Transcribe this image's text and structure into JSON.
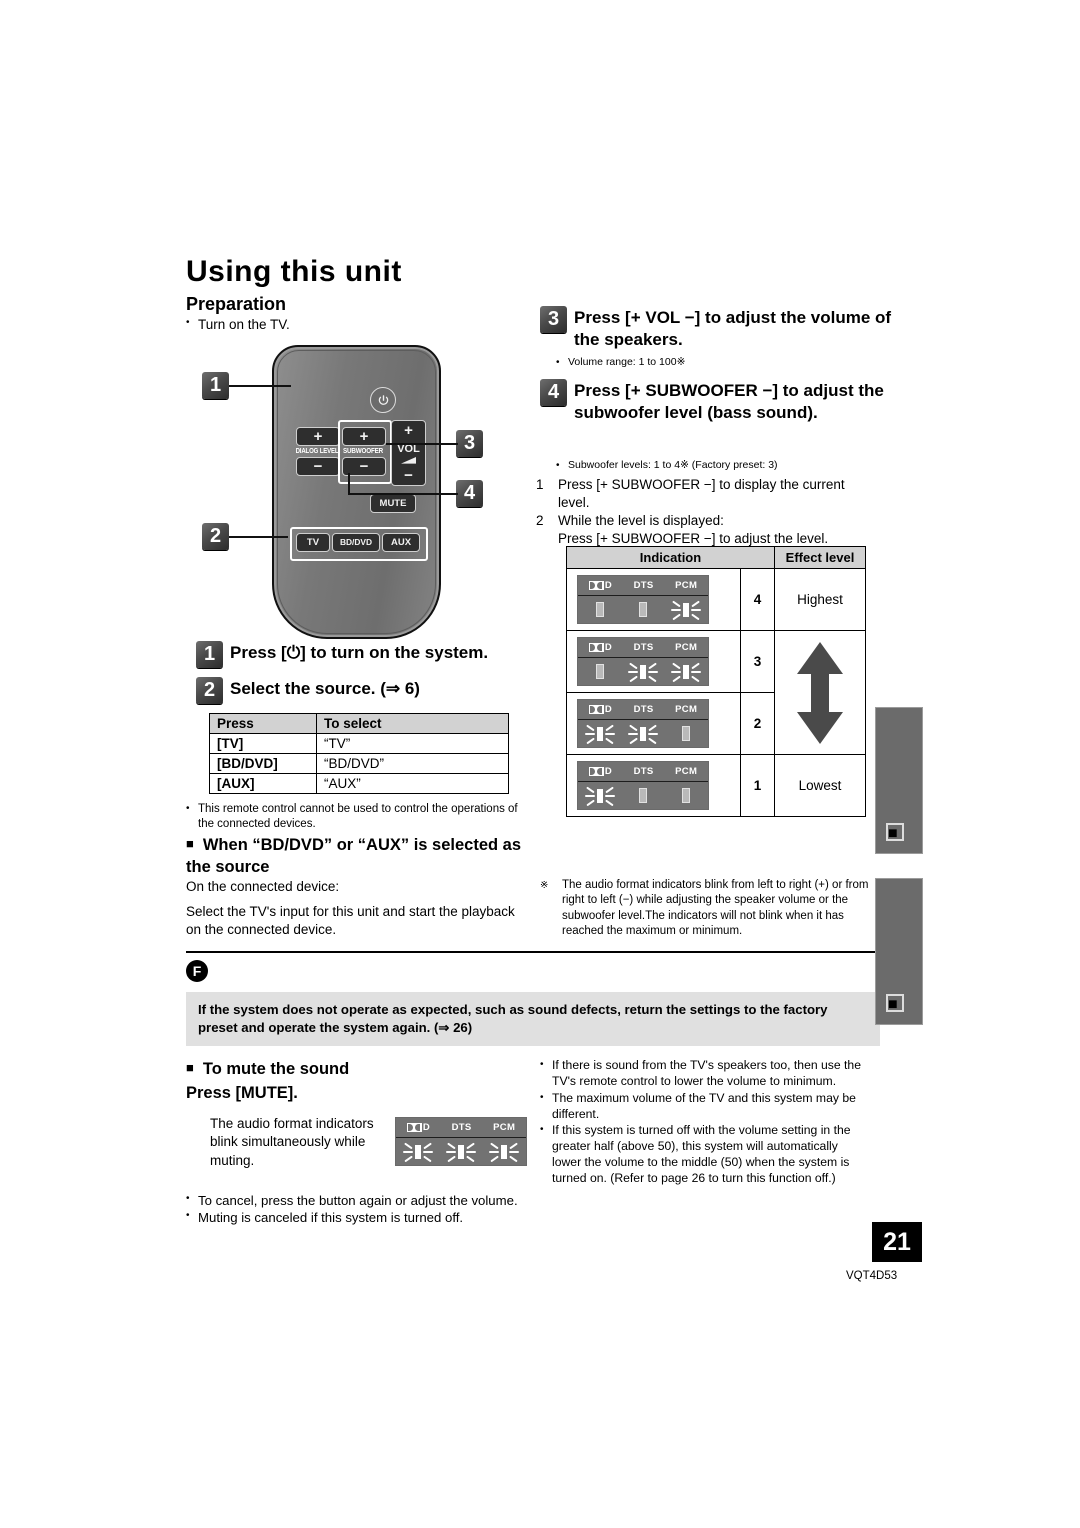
{
  "page": {
    "title": "Using this unit",
    "number": "21",
    "doc_code": "VQT4D53",
    "section_mark": "F"
  },
  "preparation": {
    "heading": "Preparation",
    "bullet": "Turn on the TV."
  },
  "remote": {
    "power_icon": "power-icon",
    "buttons": {
      "dialog_level": "DIALOG LEVEL",
      "subwoofer": "SUBWOOFER",
      "vol": "VOL",
      "mute": "MUTE",
      "tv": "TV",
      "bddvd": "BD/DVD",
      "aux": "AUX",
      "plus": "+",
      "minus": "−"
    },
    "callouts": [
      "1",
      "2",
      "3",
      "4"
    ]
  },
  "steps": {
    "s1": {
      "num": "1",
      "text": "Press [⏻] to turn on the system."
    },
    "s2": {
      "num": "2",
      "text": "Select the source. (⇒ 6)"
    },
    "s3": {
      "num": "3",
      "text": "Press [+ VOL −] to adjust the volume of the speakers.",
      "bullet": "Volume range: 1 to 100※"
    },
    "s4": {
      "num": "4",
      "text": "Press [+ SUBWOOFER −] to adjust the subwoofer level (bass sound).",
      "bullet": "Subwoofer levels: 1 to 4※ (Factory preset: 3)",
      "sub1_num": "1",
      "sub1": "Press [+ SUBWOOFER −] to display the current level.",
      "sub2_num": "2",
      "sub2": "While the level is displayed:",
      "sub2b": "Press [+ SUBWOOFER −] to adjust the level."
    }
  },
  "source_table": {
    "headers": [
      "Press",
      "To select"
    ],
    "rows": [
      [
        "[TV]",
        "“TV”"
      ],
      [
        "[BD/DVD]",
        "“BD/DVD”"
      ],
      [
        "[AUX]",
        "“AUX”"
      ]
    ]
  },
  "notes": {
    "remote_note": "This remote control cannot be used to control the operations of the connected devices.",
    "bdvd_heading": "When “BD/DVD” or “AUX” is selected as the source",
    "on_connected": "On the connected device:",
    "select_input": "Select the TV's input for this unit and start the playback on the connected device."
  },
  "indication_table": {
    "headers": [
      "Indication",
      "Effect level"
    ],
    "display_labels": [
      "D",
      "DTS",
      "PCM"
    ],
    "rows": [
      {
        "level": "4",
        "effect": "Highest",
        "lit": [
          false,
          false,
          true
        ]
      },
      {
        "level": "3",
        "effect": "",
        "lit": [
          false,
          true,
          true
        ]
      },
      {
        "level": "2",
        "effect": "",
        "lit": [
          true,
          true,
          false
        ]
      },
      {
        "level": "1",
        "effect": "Lowest",
        "lit": [
          true,
          false,
          false
        ]
      }
    ],
    "arrow": "double-arrow-vertical"
  },
  "footnote": {
    "mark": "※",
    "text": "The audio format indicators blink from left to right (+) or from right to left (−) while adjusting the speaker volume or the subwoofer level.The indicators will not blink when it has reached the maximum or minimum."
  },
  "warning": {
    "text": "If the system does not operate as expected, such as sound defects, return the settings to the factory preset and operate the system again. (⇒ 26)"
  },
  "mute": {
    "heading": "To mute the sound",
    "subheading": "Press [MUTE].",
    "description": "The audio format indicators blink simultaneously while muting.",
    "bullets": [
      "To cancel, press the button again or adjust the volume.",
      "Muting is canceled if this system is turned off."
    ]
  },
  "right_bullets": [
    "If there is sound from the TV's speakers too, then use the TV's remote control to lower the volume to minimum.",
    "The maximum volume of the TV and this system may be different.",
    "If this system is turned off with the volume setting in the greater half (above 50), this system will automatically lower the volume to the middle (50) when the system is turned on. (Refer to page 26 to turn this function off.)"
  ]
}
